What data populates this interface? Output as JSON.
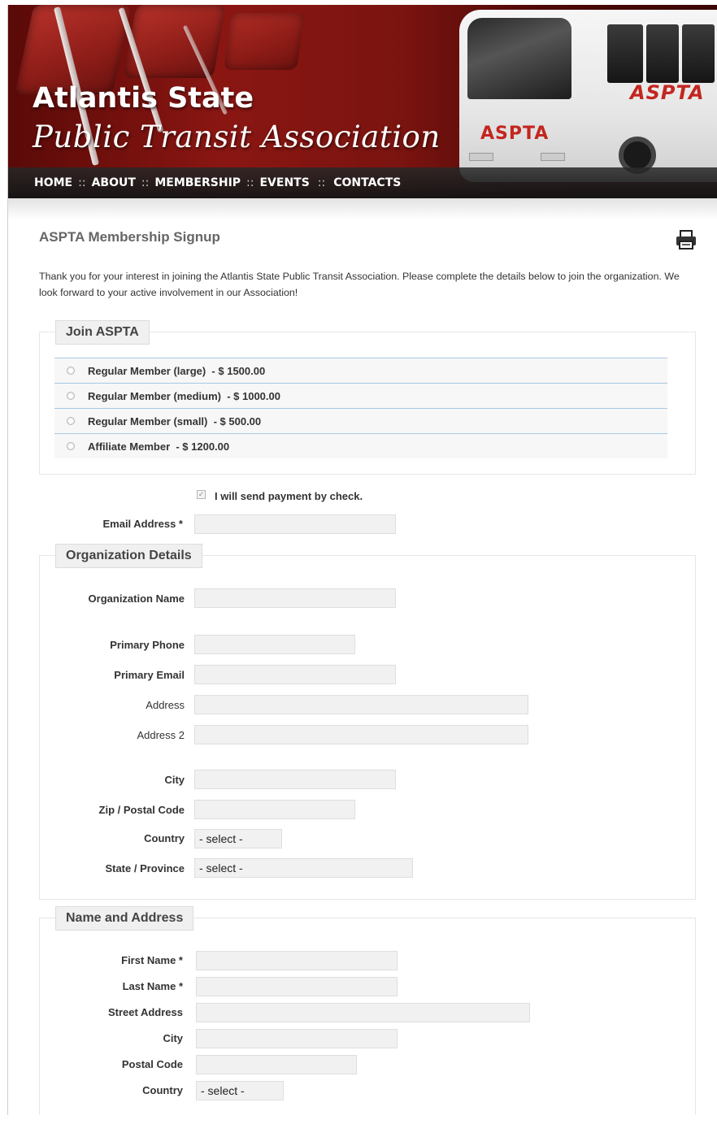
{
  "header": {
    "title": "Atlantis State",
    "subtitle": "Public Transit Association",
    "bus_brand": "ASPTA"
  },
  "nav": {
    "items": [
      "HOME",
      "ABOUT",
      "MEMBERSHIP",
      "EVENTS",
      "CONTACTS"
    ],
    "separator": "::"
  },
  "main": {
    "title": "ASPTA Membership Signup",
    "intro": "Thank you for your interest in joining the Atlantis State Public Transit Association. Please complete the details below to join the organization. We look forward to your active involvement in our Association!"
  },
  "join": {
    "legend": "Join ASPTA",
    "plans": [
      {
        "label": "Regular Member (large)  - $ 1500.00"
      },
      {
        "label": "Regular Member (medium)  - $ 1000.00"
      },
      {
        "label": "Regular Member (small)  - $ 500.00"
      },
      {
        "label": "Affiliate Member  - $ 1200.00"
      }
    ]
  },
  "payment": {
    "check_label": "I will send payment by check.",
    "checked_mark": "✓"
  },
  "email": {
    "label": "Email Address *",
    "value": ""
  },
  "organization": {
    "legend": "Organization Details",
    "name_label": "Organization Name",
    "phone_label": "Primary Phone",
    "email_label": "Primary Email",
    "address_label": "Address",
    "address2_label": "Address 2",
    "city_label": "City",
    "zip_label": "Zip / Postal Code",
    "country_label": "Country",
    "country_value": "- select -",
    "state_label": "State / Province",
    "state_value": "- select -"
  },
  "name_address": {
    "legend": "Name and Address",
    "first_label": "First Name *",
    "last_label": "Last Name *",
    "street_label": "Street Address",
    "city_label": "City",
    "postal_label": "Postal Code",
    "country_label": "Country",
    "country_value": "- select -"
  },
  "colors": {
    "banner_red": "#8a1612",
    "brand_red": "#c3261f",
    "row_border": "#a6c9e4"
  }
}
